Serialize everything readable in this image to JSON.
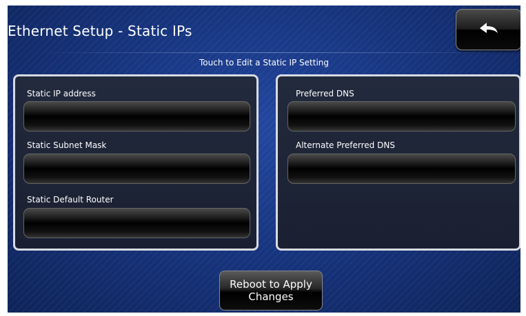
{
  "header": {
    "title": "Ethernet Setup - Static IPs",
    "back_icon": "back-arrow-icon"
  },
  "subtitle": "Touch to Edit a Static IP Setting",
  "left_panel": {
    "fields": [
      {
        "label": "Static IP address",
        "value": ""
      },
      {
        "label": "Static Subnet Mask",
        "value": ""
      },
      {
        "label": "Static Default Router",
        "value": ""
      }
    ]
  },
  "right_panel": {
    "fields": [
      {
        "label": "Preferred DNS",
        "value": ""
      },
      {
        "label": "Alternate Preferred DNS",
        "value": ""
      }
    ]
  },
  "footer": {
    "reboot_label": "Reboot to Apply Changes"
  },
  "colors": {
    "background": "#16306f",
    "panel_border": "#d7dbe3",
    "text": "#ffffff"
  }
}
